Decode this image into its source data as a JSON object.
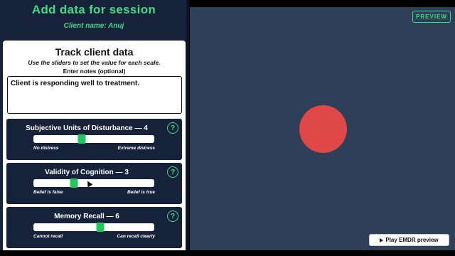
{
  "header": {
    "title": "Add data for session",
    "client_name": "Client name: Anuj"
  },
  "card": {
    "title": "Track client data",
    "subtitle": "Use the sliders to set the value for each scale.",
    "notes_label": "Enter notes (optional)",
    "notes_value": "Client is responding well to treatment."
  },
  "scales": [
    {
      "title": "Subjective Units of Disturbance — 4",
      "min_label": "No distress",
      "max_label": "Extreme distress",
      "value": 4,
      "min": 0,
      "max": 10,
      "help_glyph": "?"
    },
    {
      "title": "Validity of Cognition — 3",
      "min_label": "Belief is false",
      "max_label": "Belief is true",
      "value": 3,
      "min": 1,
      "max": 7,
      "help_glyph": "?"
    },
    {
      "title": "Memory Recall — 6",
      "min_label": "Cannot recall",
      "max_label": "Can recall clearly",
      "value": 6,
      "min": 1,
      "max": 10,
      "help_glyph": "?"
    }
  ],
  "preview": {
    "button_label": "PREVIEW",
    "play_label": "Play EMDR preview",
    "dot_color": "#e04848",
    "accent_color": "#3ddc84"
  }
}
